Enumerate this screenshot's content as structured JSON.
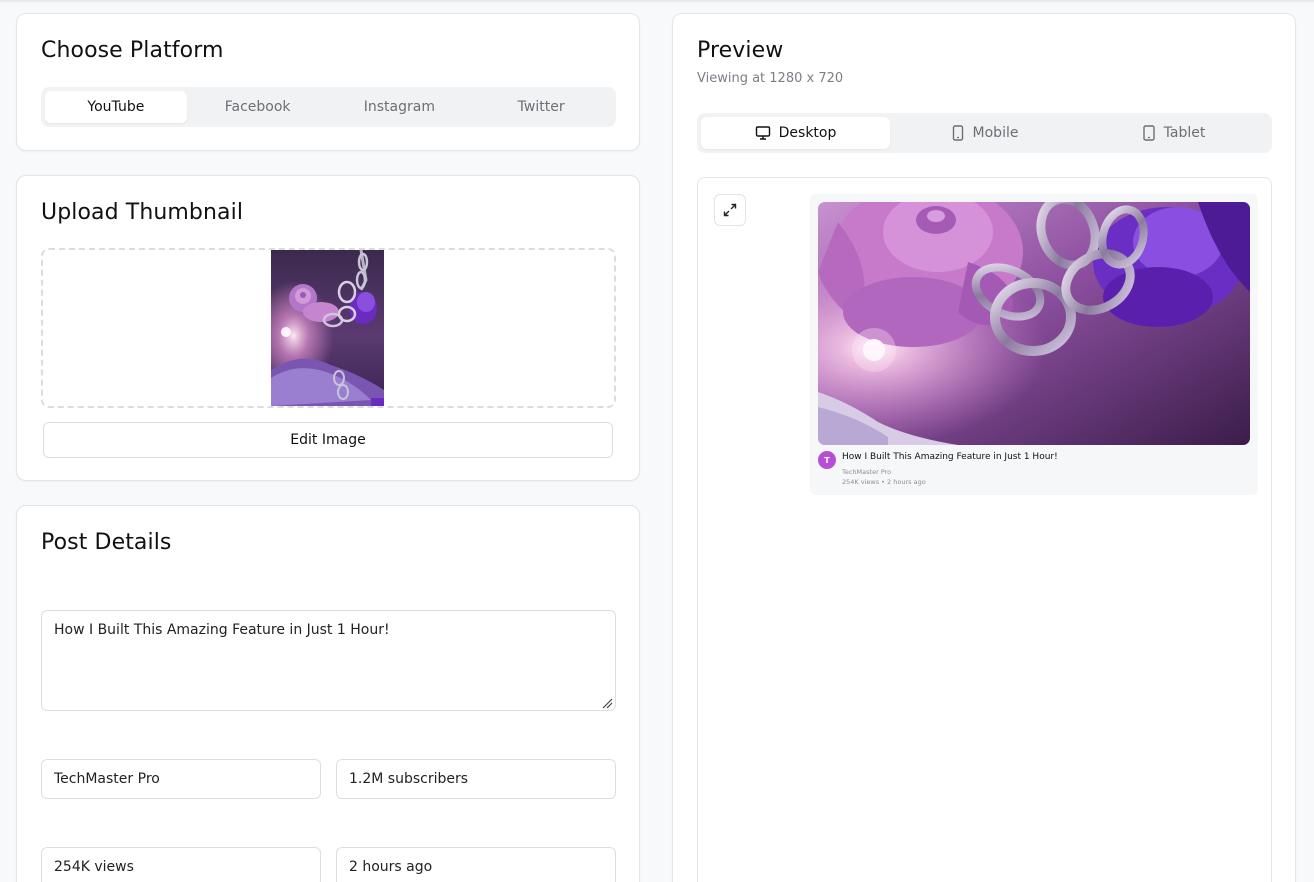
{
  "platform": {
    "title": "Choose Platform",
    "tabs": [
      "YouTube",
      "Facebook",
      "Instagram",
      "Twitter"
    ],
    "active": "YouTube"
  },
  "upload": {
    "title": "Upload Thumbnail",
    "edit_label": "Edit Image"
  },
  "post": {
    "title": "Post Details",
    "video_title": "How I Built This Amazing Feature in Just 1 Hour!",
    "channel_name": "TechMaster Pro",
    "subscribers": "1.2M subscribers",
    "views": "254K views",
    "time_ago": "2 hours ago"
  },
  "preview": {
    "title": "Preview",
    "subtitle": "Viewing at 1280 x 720",
    "devices": [
      "Desktop",
      "Mobile",
      "Tablet"
    ],
    "active_device": "Desktop",
    "card": {
      "avatar_letter": "T",
      "title": "How I Built This Amazing Feature in Just 1 Hour!",
      "channel": "TechMaster Pro",
      "meta": "254K views • 2 hours ago"
    }
  },
  "icons": {
    "desktop": "monitor-icon",
    "mobile": "smartphone-icon",
    "tablet": "tablet-icon",
    "expand": "expand-icon"
  },
  "colors": {
    "accent_avatar": "#b74fd6",
    "thumb_dark": "#3a1d4a",
    "thumb_pink": "#c06fc8",
    "thumb_violet": "#7b3fc9"
  }
}
